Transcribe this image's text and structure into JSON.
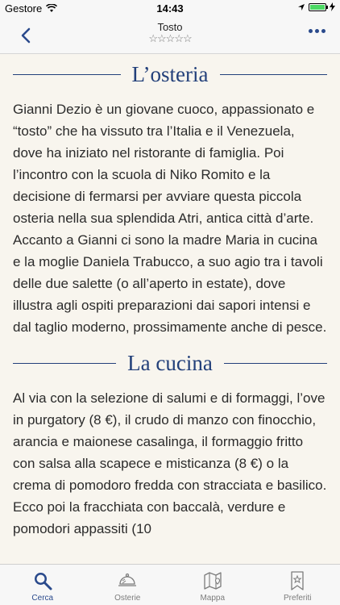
{
  "status": {
    "carrier": "Gestore",
    "time": "14:43"
  },
  "nav": {
    "title": "Tosto",
    "stars": "☆☆☆☆☆"
  },
  "sections": [
    {
      "heading": "L’osteria",
      "text": "Gianni Dezio è un giovane cuoco, appassionato e “tosto” che ha vissuto tra l’Italia e il Venezuela, dove ha iniziato nel ristorante di famiglia. Poi l’incontro con la scuola di Niko Romito e la decisione di fermarsi per avviare questa piccola osteria nella sua splendida Atri, antica città d’arte. Accanto a Gianni ci sono la madre Maria in cucina e la moglie Daniela Trabucco, a suo agio tra i tavoli delle due salette (o all’aperto in estate), dove illustra agli ospiti preparazioni dai sapori intensi e dal taglio moderno, prossimamente anche di pesce."
    },
    {
      "heading": "La cucina",
      "text": "Al via con la selezione di salumi e di formaggi, l’ove in purgatory (8 €), il crudo di manzo con finocchio, arancia e maionese casalinga, il formaggio fritto con salsa alla scapece e misticanza (8 €) o la crema di pomodoro fredda con stracciata e basilico. Ecco poi la fracchiata con baccalà, verdure e pomodori appassiti (10"
    }
  ],
  "tabs": [
    {
      "label": "Cerca",
      "icon": "search-icon",
      "active": true
    },
    {
      "label": "Osterie",
      "icon": "cloche-icon",
      "active": false
    },
    {
      "label": "Mappa",
      "icon": "map-icon",
      "active": false
    },
    {
      "label": "Preferiti",
      "icon": "bookmark-star-icon",
      "active": false
    }
  ],
  "colors": {
    "accent": "#23407a",
    "background": "#f8f5ee"
  }
}
